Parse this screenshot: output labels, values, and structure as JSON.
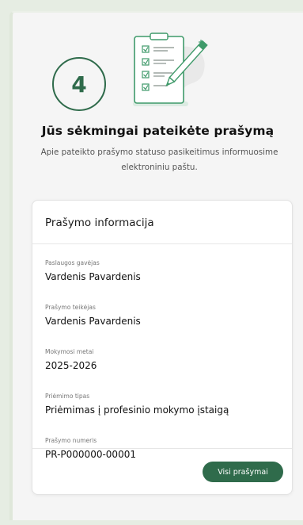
{
  "step": {
    "number": "4"
  },
  "success": {
    "title": "Jūs sėkmingai pateikėte prašymą",
    "description": "Apie pateikto prašymo statuso pasikeitimus informuosime elektroniniu paštu."
  },
  "card": {
    "title": "Prašymo informacija",
    "fields": [
      {
        "label": "Paslaugos gavėjas",
        "value": "Vardenis Pavardenis"
      },
      {
        "label": "Prašymo teikėjas",
        "value": "Vardenis Pavardenis"
      },
      {
        "label": "Mokymosi metai",
        "value": "2025-2026"
      },
      {
        "label": "Priėmimo tipas",
        "value": "Priėmimas į profesinio mokymo įstaigą"
      },
      {
        "label": "Prašymo numeris",
        "value": "PR-P000000-00001"
      }
    ],
    "button_label": "Visi prašymai"
  },
  "colors": {
    "accent": "#2f6b4b",
    "background": "#e6ede3",
    "panel": "#f5f5f5",
    "illustration_green": "#3f9a6a"
  },
  "icons": {
    "illustration": "clipboard-checklist-pencil-icon"
  }
}
